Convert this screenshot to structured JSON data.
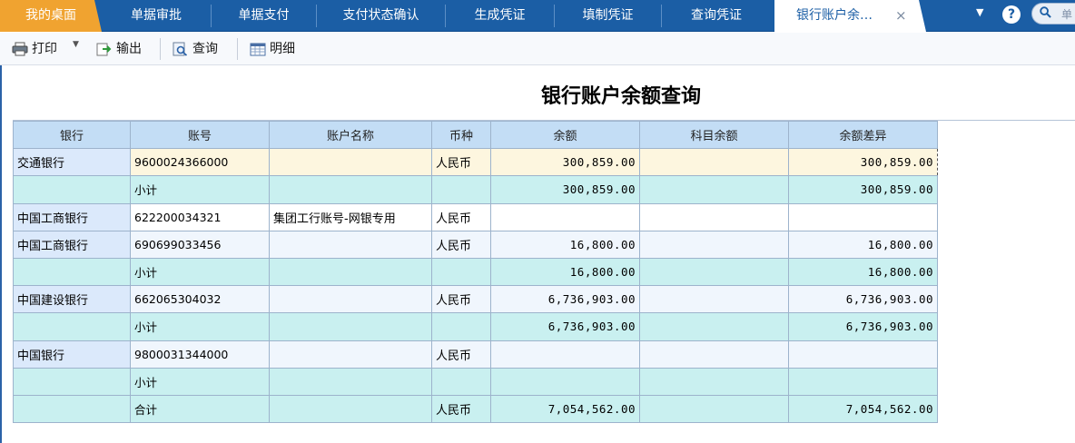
{
  "tabs": [
    {
      "label": "我的桌面",
      "kind": "home"
    },
    {
      "label": "单据审批"
    },
    {
      "label": "单据支付"
    },
    {
      "label": "支付状态确认"
    },
    {
      "label": "生成凭证"
    },
    {
      "label": "填制凭证"
    },
    {
      "label": "查询凭证"
    },
    {
      "label": "银行账户余…",
      "kind": "active"
    }
  ],
  "tab_close": "×",
  "search": {
    "placeholder": "单"
  },
  "help": "?",
  "toolbar": {
    "print": "打印",
    "export": "输出",
    "query": "查询",
    "detail": "明细"
  },
  "page_title": "银行账户余额查询",
  "table": {
    "headers": [
      "银行",
      "账号",
      "账户名称",
      "币种",
      "余额",
      "科目余额",
      "余额差异"
    ],
    "rows": [
      {
        "type": "sel",
        "bank": "交通银行",
        "account": "9600024366000",
        "name": "",
        "currency": "人民币",
        "balance": "300,859.00",
        "subject": "",
        "diff": "300,859.00"
      },
      {
        "type": "sub",
        "bank": "",
        "account": "小计",
        "name": "",
        "currency": "",
        "balance": "300,859.00",
        "subject": "",
        "diff": "300,859.00"
      },
      {
        "type": "detail",
        "bank": "中国工商银行",
        "account": "622200034321",
        "name": "集团工行账号-网银专用",
        "currency": "人民币",
        "balance": "",
        "subject": "",
        "diff": ""
      },
      {
        "type": "alt",
        "bank": "中国工商银行",
        "account": "690699033456",
        "name": "",
        "currency": "人民币",
        "balance": "16,800.00",
        "subject": "",
        "diff": "16,800.00"
      },
      {
        "type": "sub",
        "bank": "",
        "account": "小计",
        "name": "",
        "currency": "",
        "balance": "16,800.00",
        "subject": "",
        "diff": "16,800.00"
      },
      {
        "type": "alt",
        "bank": "中国建设银行",
        "account": "662065304032",
        "name": "",
        "currency": "人民币",
        "balance": "6,736,903.00",
        "subject": "",
        "diff": "6,736,903.00"
      },
      {
        "type": "sub",
        "bank": "",
        "account": "小计",
        "name": "",
        "currency": "",
        "balance": "6,736,903.00",
        "subject": "",
        "diff": "6,736,903.00"
      },
      {
        "type": "alt",
        "bank": "中国银行",
        "account": "9800031344000",
        "name": "",
        "currency": "人民币",
        "balance": "",
        "subject": "",
        "diff": ""
      },
      {
        "type": "sub",
        "bank": "",
        "account": "小计",
        "name": "",
        "currency": "",
        "balance": "",
        "subject": "",
        "diff": ""
      },
      {
        "type": "sub",
        "bank": "",
        "account": "合计",
        "name": "",
        "currency": "人民币",
        "balance": "7,054,562.00",
        "subject": "",
        "diff": "7,054,562.00"
      }
    ]
  },
  "icons": {
    "print": "printer-icon",
    "export": "export-icon",
    "query": "query-icon",
    "detail": "detail-icon",
    "search": "search-icon",
    "help": "help-icon",
    "menu": "chevron-down-icon"
  },
  "colors": {
    "tabbar": "#1b5ea5",
    "home_tab": "#f0a330",
    "header_row": "#c3ddf5",
    "subtotal_row": "#c9f0f0",
    "selected_row": "#fdf6df"
  }
}
